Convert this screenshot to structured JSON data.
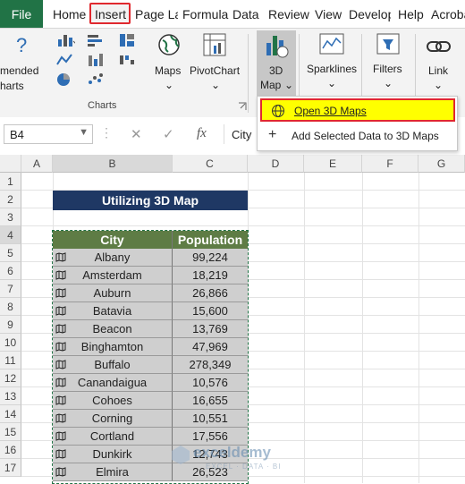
{
  "ribbon_tabs": [
    "File",
    "Home",
    "Insert",
    "Page La",
    "Formula",
    "Data",
    "Review",
    "View",
    "Develop",
    "Help",
    "Acroba"
  ],
  "ribbon": {
    "recommended_charts_partial": "mended",
    "recommended_charts_partial2": "harts",
    "charts_group_label": "Charts",
    "maps_label": "Maps",
    "pivotchart_label": "PivotChart",
    "map3d_label_line1": "3D",
    "map3d_label_line2": "Map",
    "sparklines_label": "Sparklines",
    "filters_label": "Filters",
    "link_label": "Link"
  },
  "dropdown": {
    "item1": "Open 3D Maps",
    "item2": "Add Selected Data to 3D Maps"
  },
  "formula_bar": {
    "name_box": "B4",
    "fx": "fx",
    "value": "City"
  },
  "columns": [
    "A",
    "B",
    "C",
    "D",
    "E",
    "F",
    "G"
  ],
  "rows": [
    "1",
    "2",
    "3",
    "4",
    "5",
    "6",
    "7",
    "8",
    "9",
    "10",
    "11",
    "12",
    "13",
    "14",
    "15",
    "16",
    "17"
  ],
  "sheet": {
    "title": "Utilizing 3D Map",
    "header_city": "City",
    "header_population": "Population",
    "data": [
      {
        "city": "Albany",
        "population": "99,224"
      },
      {
        "city": "Amsterdam",
        "population": "18,219"
      },
      {
        "city": "Auburn",
        "population": "26,866"
      },
      {
        "city": "Batavia",
        "population": "15,600"
      },
      {
        "city": "Beacon",
        "population": "13,769"
      },
      {
        "city": "Binghamton",
        "population": "47,969"
      },
      {
        "city": "Buffalo",
        "population": "278,349"
      },
      {
        "city": "Canandaigua",
        "population": "10,576"
      },
      {
        "city": "Cohoes",
        "population": "16,655"
      },
      {
        "city": "Corning",
        "population": "10,551"
      },
      {
        "city": "Cortland",
        "population": "17,556"
      },
      {
        "city": "Dunkirk",
        "population": "12,743"
      },
      {
        "city": "Elmira",
        "population": "26,523"
      }
    ]
  },
  "watermark": {
    "brand": "exceldemy",
    "tagline": "EXCEL · DATA · BI"
  },
  "colors": {
    "file_tab": "#217346",
    "title_bg": "#1f3864",
    "header_bg": "#5e7c45",
    "highlight": "#ffff00",
    "red_outline": "#e0282e"
  }
}
